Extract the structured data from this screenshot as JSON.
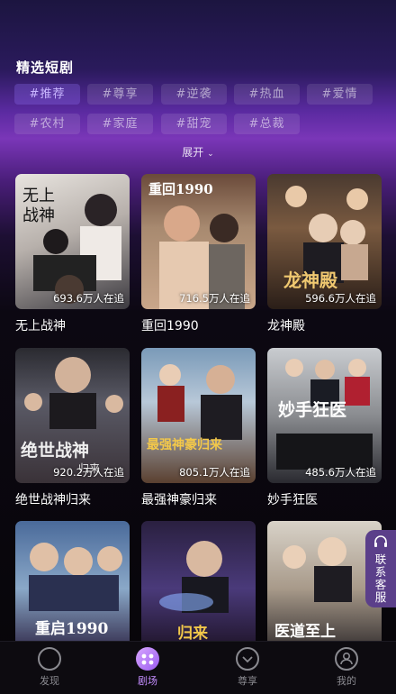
{
  "section_title": "精选短剧",
  "tags": [
    "#推荐",
    "#尊享",
    "#逆袭",
    "#热血",
    "#爱情",
    "#农村",
    "#家庭",
    "#甜宠",
    "#总裁"
  ],
  "active_tag": "#推荐",
  "expand_label": "展开",
  "dramas": [
    {
      "name": "无上战神",
      "count": "693.6万人在追",
      "poster_text": "无上战神"
    },
    {
      "name": "重回1990",
      "count": "716.5万人在追",
      "poster_text": "重回1990"
    },
    {
      "name": "龙神殿",
      "count": "596.6万人在追",
      "poster_text": "龙神殿"
    },
    {
      "name": "绝世战神归来",
      "count": "920.2万人在追",
      "poster_text": "绝世战神归来"
    },
    {
      "name": "最强神豪归来",
      "count": "805.1万人在追",
      "poster_text": "最强神豪归来"
    },
    {
      "name": "妙手狂医",
      "count": "485.6万人在追",
      "poster_text": "妙手狂医"
    },
    {
      "name": "",
      "count": "",
      "poster_text": "重启1990"
    },
    {
      "name": "",
      "count": "",
      "poster_text": "归来"
    },
    {
      "name": "",
      "count": "",
      "poster_text": "医道至上"
    }
  ],
  "customer_service": {
    "label": "联系客服"
  },
  "tabbar": [
    {
      "label": "发现",
      "icon": "discover-icon"
    },
    {
      "label": "剧场",
      "icon": "theater-icon"
    },
    {
      "label": "尊享",
      "icon": "vip-icon"
    },
    {
      "label": "我的",
      "icon": "profile-icon"
    }
  ],
  "active_tab": "剧场"
}
